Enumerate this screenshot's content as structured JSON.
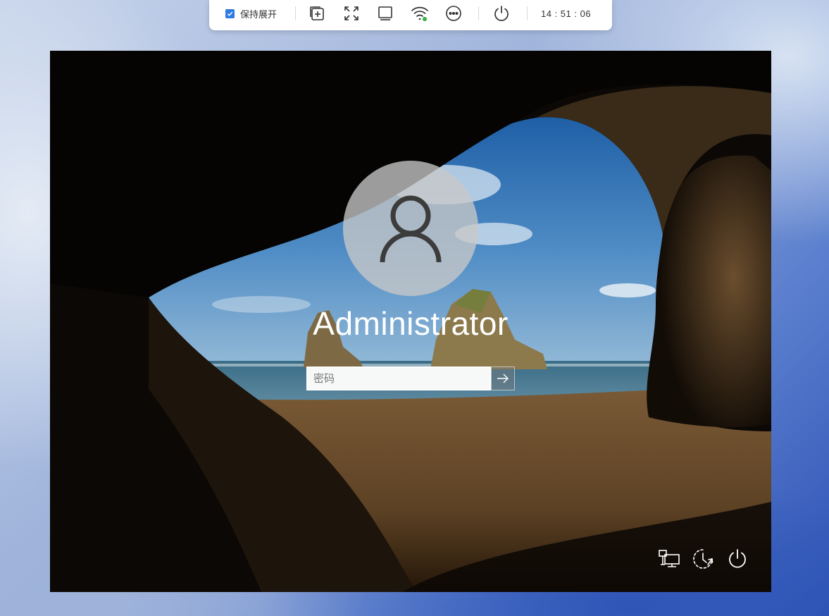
{
  "toolbar": {
    "keep_expanded_label": "保持展开",
    "keep_expanded_checked": true,
    "clock": "14 : 51 : 06",
    "icons": [
      "add-window-icon",
      "fullscreen-icon",
      "display-icon",
      "wifi-icon",
      "more-icon",
      "power-icon"
    ],
    "wifi_status_color": "#3cb44b",
    "accent": "#2f7ae5"
  },
  "login": {
    "username": "Administrator",
    "password": {
      "value": "",
      "placeholder": "密码"
    },
    "submit_icon": "arrow-right-icon"
  },
  "corner": {
    "icons": [
      "network-icon",
      "ease-of-access-icon",
      "power-icon"
    ]
  }
}
